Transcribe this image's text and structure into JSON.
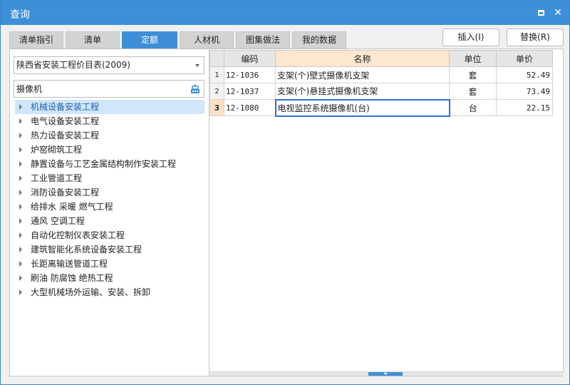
{
  "window": {
    "title": "查询"
  },
  "tabs": [
    {
      "label": "清单指引",
      "active": false
    },
    {
      "label": "清单",
      "active": false
    },
    {
      "label": "定额",
      "active": true
    },
    {
      "label": "人材机",
      "active": false
    },
    {
      "label": "图集做法",
      "active": false
    },
    {
      "label": "我的数据",
      "active": false
    }
  ],
  "actions": {
    "insert_label": "插入(I)",
    "replace_label": "替换(R)"
  },
  "left": {
    "library_selected": "陕西省安装工程价目表(2009)",
    "search_value": "摄像机",
    "tree": [
      "机械设备安装工程",
      "电气设备安装工程",
      "热力设备安装工程",
      "炉窑砌筑工程",
      "静置设备与工艺金属结构制作安装工程",
      "工业管道工程",
      "消防设备安装工程",
      "给排水 采暖 燃气工程",
      "通风 空调工程",
      "自动化控制仪表安装工程",
      "建筑智能化系统设备安装工程",
      "长距离输送管道工程",
      "刷油 防腐蚀 绝热工程",
      "大型机械场外运输、安装、拆卸"
    ]
  },
  "grid": {
    "columns": {
      "code": "编码",
      "name": "名称",
      "unit": "单位",
      "price": "单价"
    },
    "rows": [
      {
        "index": "1",
        "code": "12-1036",
        "name": "支架(个)壁式摄像机支架",
        "unit": "套",
        "price": "52.49"
      },
      {
        "index": "2",
        "code": "12-1037",
        "name": "支架(个)悬挂式摄像机支架",
        "unit": "套",
        "price": "73.49"
      },
      {
        "index": "3",
        "code": "12-1080",
        "name": "电视监控系统摄像机(台)",
        "unit": "台",
        "price": "22.15"
      }
    ]
  },
  "colors": {
    "accent": "#3d8fd8",
    "selected_tree_bg": "#cfe6fb",
    "name_header_bg": "#fde7cf"
  },
  "icons": {
    "maximize": "maximize-icon",
    "close": "close-icon",
    "search": "search-filter-icon",
    "dropdown": "chevron-down-icon",
    "tree_expand": "caret-right-icon"
  }
}
